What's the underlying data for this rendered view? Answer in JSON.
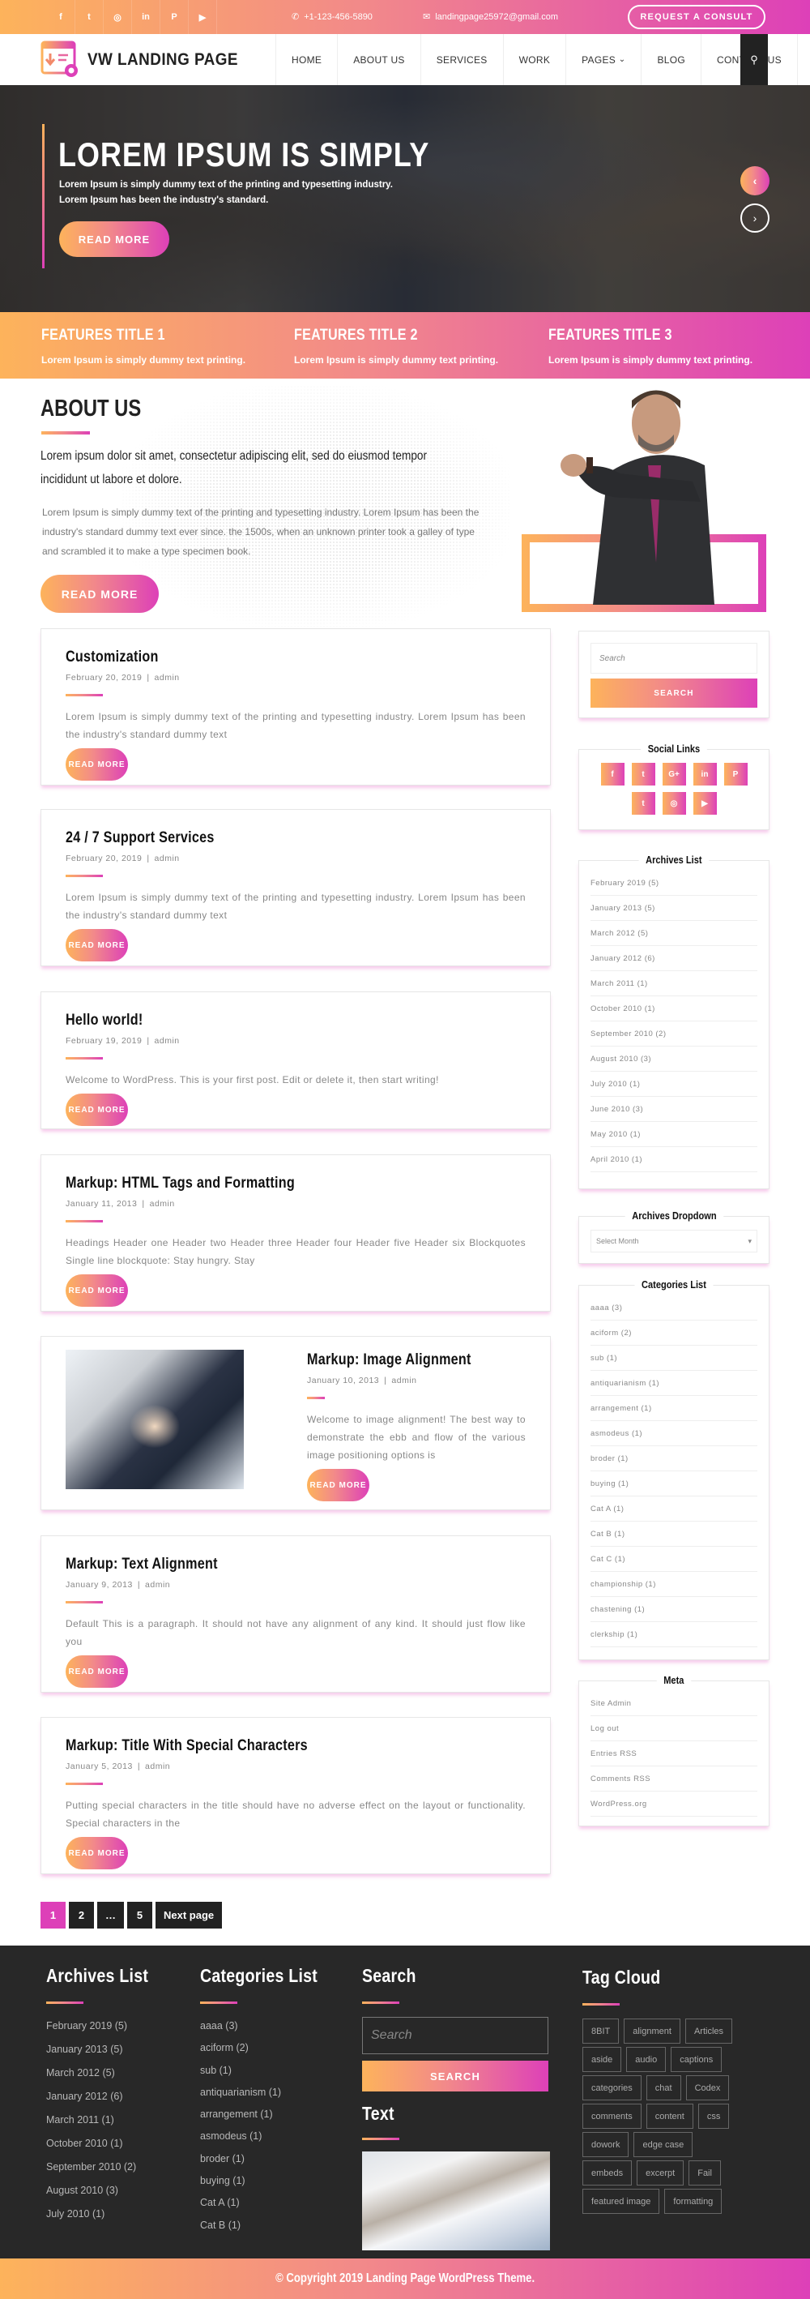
{
  "colors": {
    "gradient_start": "#fdb35b",
    "gradient_mid": "#f2898a",
    "gradient_end": "#dd40b8",
    "dark": "#222222",
    "footer_bg": "#282828"
  },
  "topbar": {
    "social_icons": [
      "facebook-icon",
      "twitter-icon",
      "instagram-icon",
      "linkedin-icon",
      "pinterest-icon",
      "youtube-icon"
    ],
    "social_glyphs": [
      "f",
      "t",
      "◎",
      "in",
      "P",
      "▶"
    ],
    "phone": "+1-123-456-5890",
    "email": "landingpage25972@gmail.com",
    "consult_label": "REQUEST A CONSULT"
  },
  "header": {
    "logo_text": "VW LANDING PAGE",
    "nav": [
      "HOME",
      "ABOUT US",
      "SERVICES",
      "WORK",
      "PAGES",
      "BLOG",
      "CONTACT US"
    ],
    "pages_chevron": "⌄"
  },
  "hero": {
    "title": "LOREM IPSUM IS SIMPLY",
    "line1": "Lorem Ipsum is simply dummy text of the printing and typesetting industry.",
    "line2": "Lorem Ipsum has been the industry's standard.",
    "button": "READ MORE",
    "prev": "‹",
    "next": "›"
  },
  "features": [
    {
      "title": "FEATURES TITLE 1",
      "text": "Lorem Ipsum is simply dummy text printing."
    },
    {
      "title": "FEATURES TITLE 2",
      "text": "Lorem Ipsum is simply dummy text printing."
    },
    {
      "title": "FEATURES TITLE 3",
      "text": "Lorem Ipsum is simply dummy text printing."
    }
  ],
  "about": {
    "title": "ABOUT US",
    "lead": "Lorem ipsum dolor sit amet, consectetur adipiscing elit, sed do eiusmod tempor incididunt ut labore et dolore.",
    "body": "Lorem Ipsum is simply dummy text of the printing and typesetting industry. Lorem Ipsum has been the industry's standard dummy text ever since. the 1500s, when an unknown printer took a galley of type and scrambled it to make a type specimen book.",
    "button": "READ MORE"
  },
  "posts": [
    {
      "title": "Customization",
      "date": "February 20, 2019",
      "author": "admin",
      "excerpt": "Lorem Ipsum is simply dummy text of the printing and typesetting industry. Lorem Ipsum has been the industry's standard dummy text",
      "button": "READ MORE"
    },
    {
      "title": "24 / 7 Support Services",
      "date": "February 20, 2019",
      "author": "admin",
      "excerpt": "Lorem Ipsum is simply dummy text of the printing and typesetting industry. Lorem Ipsum has been the industry's standard dummy text",
      "button": "READ MORE"
    },
    {
      "title": "Hello world!",
      "date": "February 19, 2019",
      "author": "admin",
      "excerpt": "Welcome to WordPress. This is your first post. Edit or delete it, then start writing!",
      "button": "READ MORE"
    },
    {
      "title": "Markup: HTML Tags and Formatting",
      "date": "January 11, 2013",
      "author": "admin",
      "excerpt": "Headings Header one Header two Header three Header four Header five Header six Blockquotes Single line blockquote: Stay hungry. Stay",
      "button": "READ MORE"
    },
    {
      "title": "Markup: Image Alignment",
      "date": "January 10, 2013",
      "author": "admin",
      "excerpt": "Welcome to image alignment! The best way to demonstrate the ebb and flow of the various image positioning options is",
      "button": "READ MORE"
    },
    {
      "title": "Markup: Text Alignment",
      "date": "January 9, 2013",
      "author": "admin",
      "excerpt": "Default This is a paragraph. It should not have any alignment of any kind. It should just flow like you",
      "button": "READ MORE"
    },
    {
      "title": "Markup: Title With Special Characters",
      "date": "January 5, 2013",
      "author": "admin",
      "excerpt": "Putting special characters in the title should have no adverse effect on the layout or functionality. Special characters in the",
      "button": "READ MORE"
    }
  ],
  "meta_separator": "|",
  "pagination": [
    "1",
    "2",
    "…",
    "5",
    "Next page"
  ],
  "sidebar": {
    "search_placeholder": "Search",
    "search_button": "SEARCH",
    "social_title": "Social Links",
    "social_icons": [
      "facebook-icon",
      "twitter-icon",
      "google-plus-icon",
      "linkedin-icon",
      "pinterest-icon",
      "tumblr-icon",
      "instagram-icon",
      "youtube-icon"
    ],
    "social_glyphs": [
      "f",
      "t",
      "G+",
      "in",
      "P",
      "t",
      "◎",
      "▶"
    ],
    "archives_title": "Archives List",
    "archives": [
      "February 2019 (5)",
      "January 2013 (5)",
      "March 2012 (5)",
      "January 2012 (6)",
      "March 2011 (1)",
      "October 2010 (1)",
      "September 2010 (2)",
      "August 2010 (3)",
      "July 2010 (1)",
      "June 2010 (3)",
      "May 2010 (1)",
      "April 2010 (1)"
    ],
    "dropdown_title": "Archives Dropdown",
    "dropdown_value": "Select Month",
    "categories_title": "Categories List",
    "categories": [
      "aaaa (3)",
      "aciform (2)",
      "sub (1)",
      "antiquarianism (1)",
      "arrangement (1)",
      "asmodeus (1)",
      "broder (1)",
      "buying (1)",
      "Cat A (1)",
      "Cat B (1)",
      "Cat C (1)",
      "championship (1)",
      "chastening (1)",
      "clerkship (1)"
    ],
    "meta_title": "Meta",
    "meta": [
      "Site Admin",
      "Log out",
      "Entries RSS",
      "Comments RSS",
      "WordPress.org"
    ]
  },
  "footer": {
    "archives_title": "Archives List",
    "archives": [
      "February 2019 (5)",
      "January 2013 (5)",
      "March 2012 (5)",
      "January 2012 (6)",
      "March 2011 (1)",
      "October 2010 (1)",
      "September 2010 (2)",
      "August 2010 (3)",
      "July 2010 (1)"
    ],
    "categories_title": "Categories List",
    "categories": [
      "aaaa (3)",
      "aciform (2)",
      "sub (1)",
      "antiquarianism (1)",
      "arrangement (1)",
      "asmodeus (1)",
      "broder (1)",
      "buying (1)",
      "Cat A (1)",
      "Cat B (1)"
    ],
    "search_title": "Search",
    "search_placeholder": "Search",
    "search_button": "SEARCH",
    "text_title": "Text",
    "tags_title": "Tag Cloud",
    "tags": [
      "8BIT",
      "alignment",
      "Articles",
      "aside",
      "audio",
      "captions",
      "categories",
      "chat",
      "Codex",
      "comments",
      "content",
      "css",
      "dowork",
      "edge case",
      "embeds",
      "excerpt",
      "Fail",
      "featured image",
      "formatting"
    ],
    "copyright": "© Copyright 2019 Landing Page WordPress Theme."
  }
}
